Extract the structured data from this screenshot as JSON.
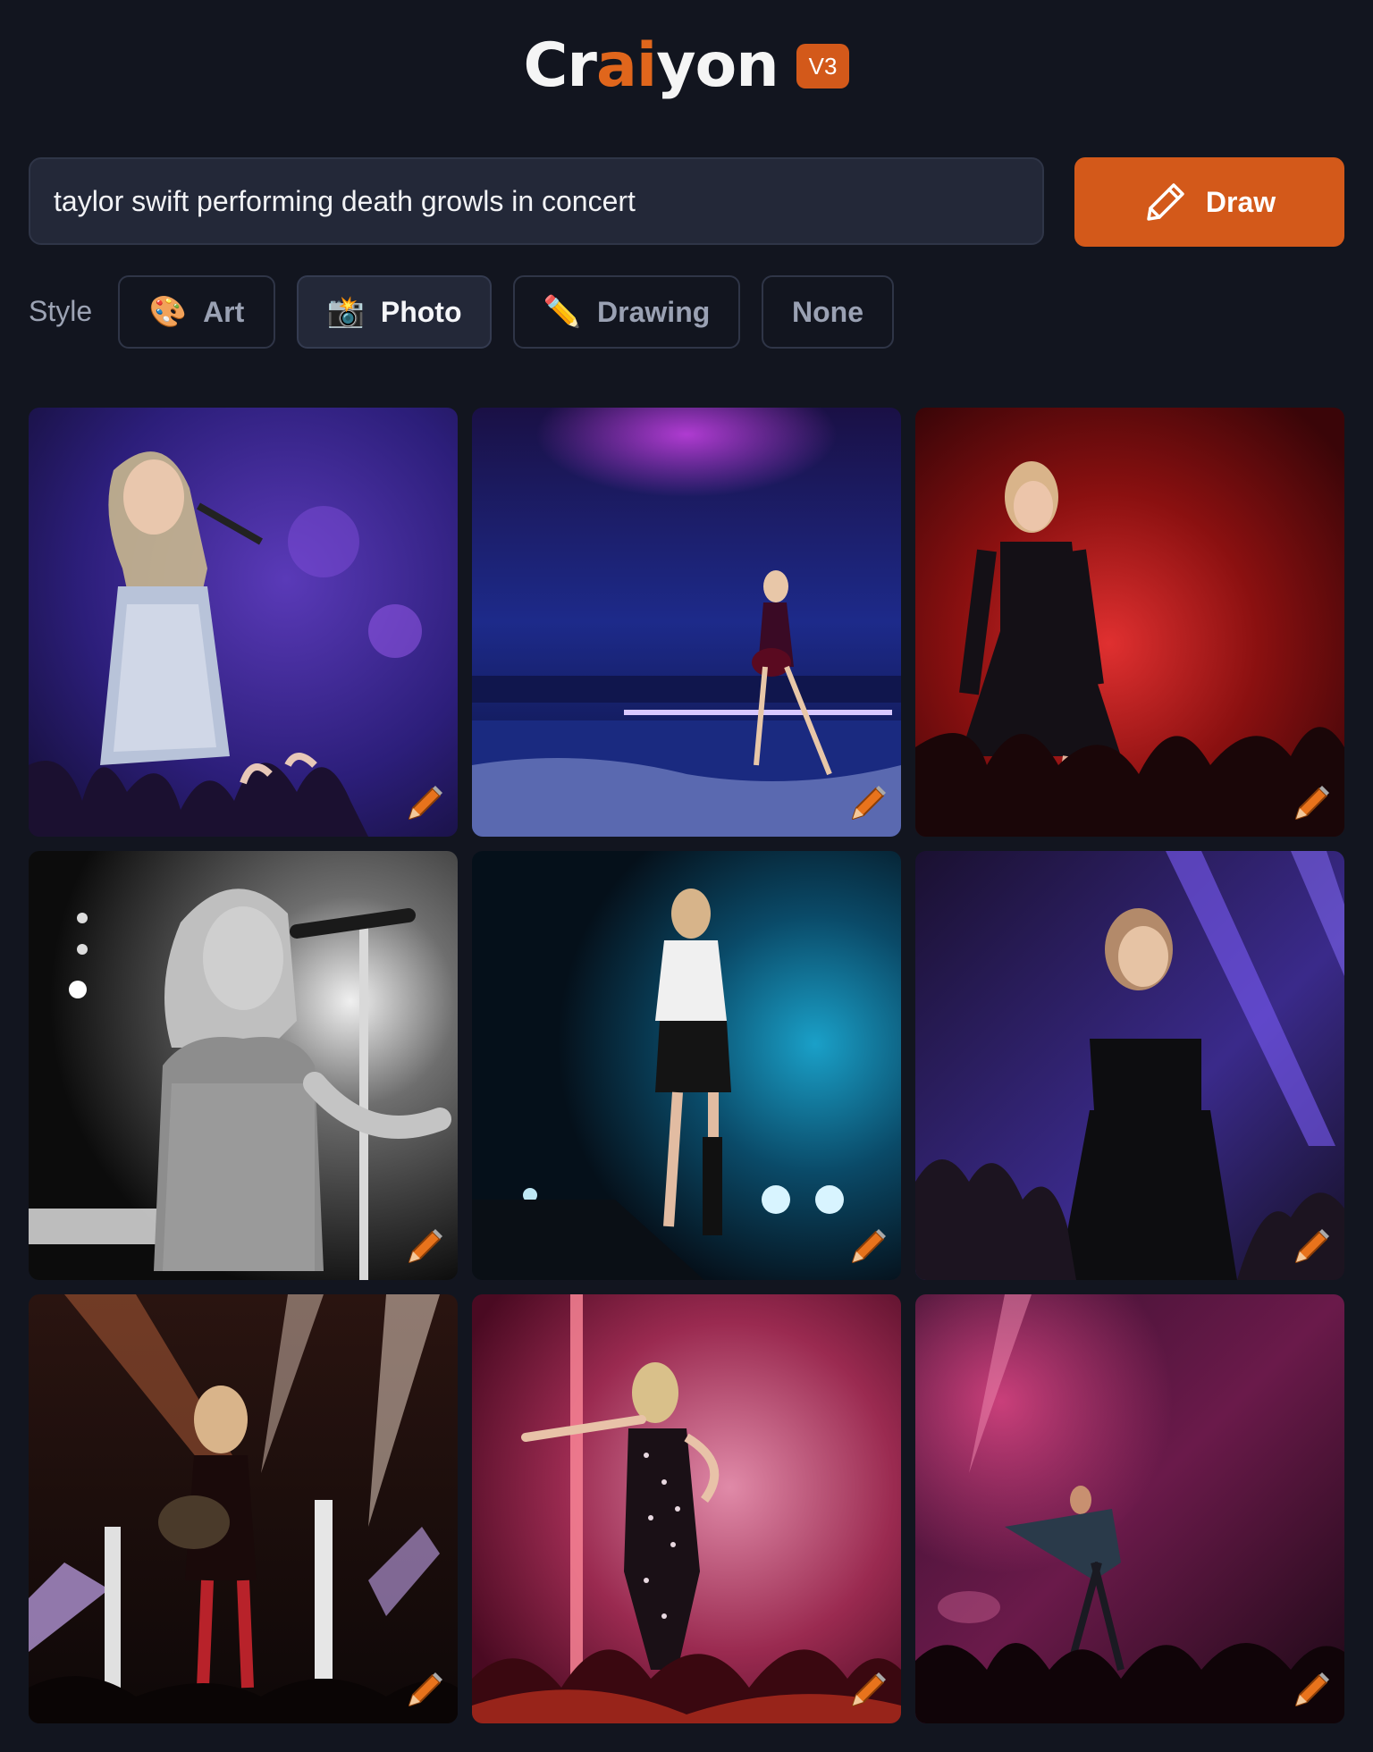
{
  "header": {
    "logo_part1": "Cr",
    "logo_part2": "ai",
    "logo_part3": "yon",
    "version": "V3"
  },
  "prompt": {
    "value": "taylor swift performing death growls in concert"
  },
  "draw_button": {
    "label": "Draw",
    "icon": "pencil-icon"
  },
  "style": {
    "label": "Style",
    "options": [
      {
        "emoji": "🎨",
        "label": "Art",
        "selected": false
      },
      {
        "emoji": "📸",
        "label": "Photo",
        "selected": true
      },
      {
        "emoji": "✏️",
        "label": "Drawing",
        "selected": false
      },
      {
        "emoji": "",
        "label": "None",
        "selected": false
      }
    ]
  },
  "results": {
    "images": [
      {
        "scene": "singer-sparkle-dress-purple-stage"
      },
      {
        "scene": "guitarist-blue-stage-purple-lights"
      },
      {
        "scene": "singer-black-dress-red-stage"
      },
      {
        "scene": "singer-black-and-white-mic-stand"
      },
      {
        "scene": "singer-white-top-teal-lights"
      },
      {
        "scene": "singer-black-outfit-blue-beams"
      },
      {
        "scene": "guitarist-warm-spotlights"
      },
      {
        "scene": "singer-patterned-jumpsuit-pink-stage"
      },
      {
        "scene": "performer-dark-pink-stage"
      }
    ],
    "edit_icon": "pencil-icon"
  },
  "colors": {
    "background": "#12151f",
    "accent": "#d3591a",
    "input_bg": "#232838"
  }
}
